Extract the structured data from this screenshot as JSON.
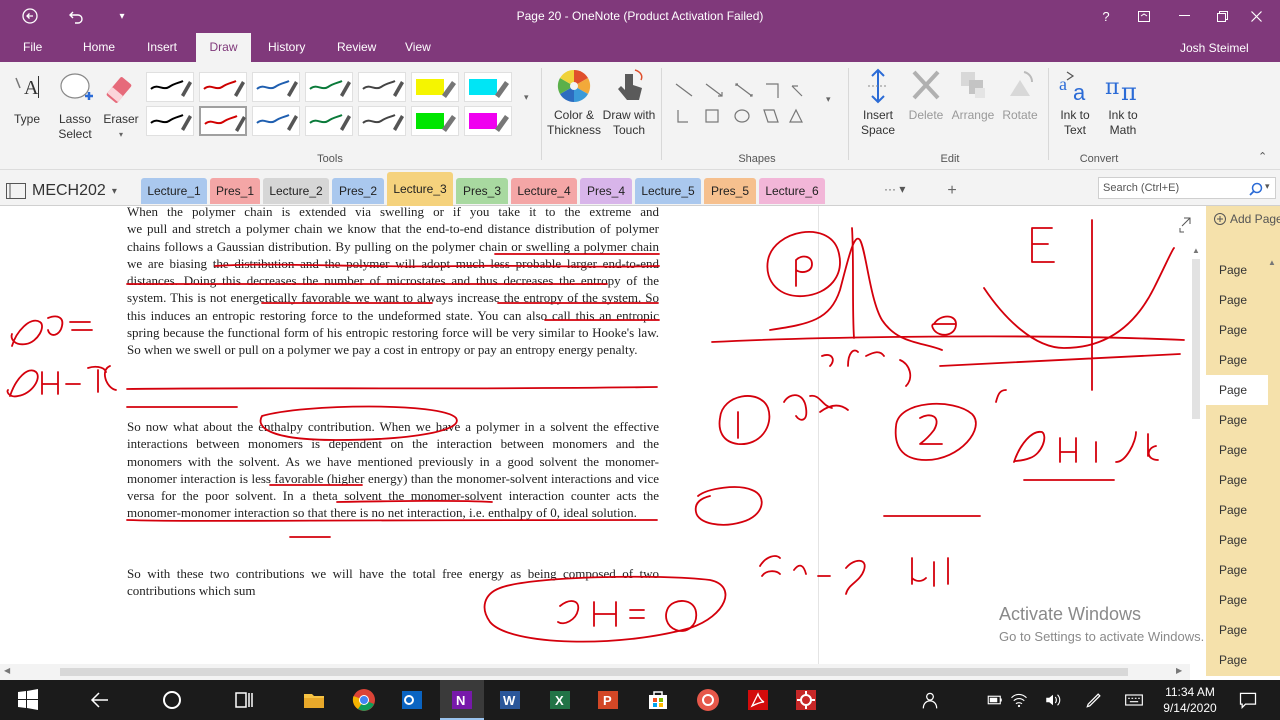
{
  "window": {
    "title": "Page 20 - OneNote (Product Activation Failed)",
    "user": "Josh Steimel"
  },
  "menu": {
    "tabs": [
      "File",
      "Home",
      "Insert",
      "Draw",
      "History",
      "Review",
      "View"
    ],
    "active": "Draw"
  },
  "ribbon": {
    "type_label": "Type",
    "lasso_label": "Lasso Select",
    "eraser_label": "Eraser",
    "tools_group": "Tools",
    "color_label": "Color & Thickness",
    "draw_touch_label": "Draw with Touch",
    "shapes_group": "Shapes",
    "insert_space_label": "Insert Space",
    "delete_label": "Delete",
    "arrange_label": "Arrange",
    "rotate_label": "Rotate",
    "edit_group": "Edit",
    "ink_text_label": "Ink to Text",
    "ink_math_label": "Ink to Math",
    "convert_group": "Convert",
    "pen_colors": [
      "#000000",
      "#cc0000",
      "#1f5fb0",
      "#0a7a3a",
      "#444444",
      "#f5f500",
      "#00e5f5",
      "#000000",
      "#d20000",
      "#1f5fb0",
      "#0a7a3a",
      "#444444",
      "#00e600",
      "#f000f0"
    ]
  },
  "notebook": {
    "name": "MECH202",
    "search_placeholder": "Search (Ctrl+E)",
    "sections": [
      {
        "label": "Lecture_1",
        "color": "#aac8ee"
      },
      {
        "label": "Pres_1",
        "color": "#f4a6a6"
      },
      {
        "label": "Lecture_2",
        "color": "#d6d6d6"
      },
      {
        "label": "Pres_2",
        "color": "#aac8ee"
      },
      {
        "label": "Lecture_3",
        "color": "#f5d27d"
      },
      {
        "label": "Pres_3",
        "color": "#a8d9a0"
      },
      {
        "label": "Lecture_4",
        "color": "#f4a6a6"
      },
      {
        "label": "Pres_4",
        "color": "#d8b5ea"
      },
      {
        "label": "Lecture_5",
        "color": "#aac8ee"
      },
      {
        "label": "Pres_5",
        "color": "#f6c08e"
      },
      {
        "label": "Lecture_6",
        "color": "#f2b6d8"
      }
    ],
    "active_section": "Lecture_3"
  },
  "pages": {
    "add_page": "Add Page",
    "items": [
      "Page",
      "Page",
      "Page",
      "Page",
      "Page",
      "Page",
      "Page",
      "Page",
      "Page",
      "Page",
      "Page",
      "Page",
      "Page",
      "Page"
    ],
    "selected_index": 4
  },
  "document": {
    "p1_line0": "When the polymer chain is extended via swelling or if you take it to the extreme and",
    "p1_rest": "we pull and stretch a polymer chain we know that the end-to-end distance distribution of polymer chains follows a Gaussian distribution. By pulling on the polymer chain or swelling a polymer chain we are biasing the distribution and the polymer will adopt much less probable larger end-to-end distances. Doing this decreases the number of microstates and thus decreases the entropy of the system. This is not energetically favorable we want to always increase the entropy of the system. So this induces an entropic restoring force to the undeformed state. You can also call this an entropic spring because the functional form of his entropic restoring force will be very similar to Hooke's law. So when we swell or pull on a polymer we pay a cost in entropy or pay an entropy energy penalty.",
    "p2": "So now what about the enthalpy contribution. When we have a polymer in a solvent the effective interactions between monomers is dependent on the interaction between monomers and the monomers with the solvent. As we have mentioned previously in a good solvent the monomer-monomer interaction is less favorable (higher energy) than the monomer-solvent interactions and vice versa for the poor solvent. In a theta solvent the monomer-solvent interaction counter acts the monomer-monomer interaction so that there is no net interaction, i.e. enthalpy of 0, ideal solution.",
    "p3": "So with these two contributions we will have the total free energy as being composed of two contributions which sum"
  },
  "watermark": {
    "line1": "Activate Windows",
    "line2": "Go to Settings to activate Windows."
  },
  "taskbar": {
    "time": "11:34 AM",
    "date": "9/14/2020"
  }
}
